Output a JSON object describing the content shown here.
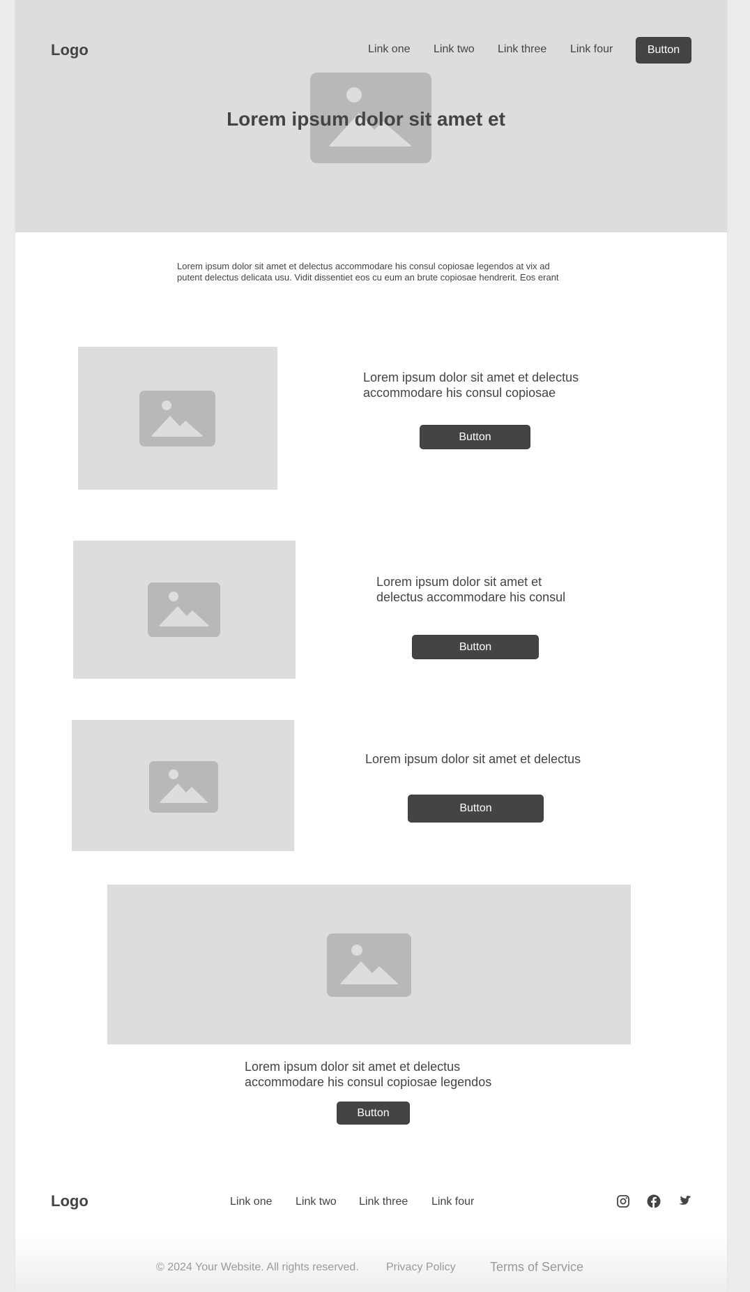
{
  "header": {
    "logo": "Logo",
    "nav": [
      "Link one",
      "Link two",
      "Link three",
      "Link four"
    ],
    "cta_label": "Button"
  },
  "hero": {
    "title": "Lorem ipsum dolor sit amet et",
    "image_icon": "image-placeholder-icon"
  },
  "intro": {
    "text": "Lorem ipsum dolor sit amet et delectus accommodare his consul copiosae legendos at vix ad putent delectus delicata usu. Vidit dissentiet eos cu eum an brute copiosae hendrerit. Eos erant"
  },
  "features": [
    {
      "text": "Lorem ipsum dolor sit amet et delectus accommodare his consul copiosae",
      "button": "Button"
    },
    {
      "text": "Lorem ipsum dolor sit amet et delectus accommodare his consul",
      "button": "Button"
    },
    {
      "text": "Lorem ipsum dolor sit amet et delectus",
      "button": "Button"
    }
  ],
  "banner": {
    "text": "Lorem ipsum dolor sit amet et delectus accommodare his consul copiosae legendos",
    "button": "Button"
  },
  "footer": {
    "logo": "Logo",
    "nav": [
      "Link one",
      "Link two",
      "Link three",
      "Link four"
    ],
    "social": [
      "instagram-icon",
      "facebook-icon",
      "twitter-icon"
    ],
    "copyright": "© 2024 Your Website. All rights reserved.",
    "privacy": "Privacy Policy",
    "terms": "Terms of Service"
  },
  "colors": {
    "placeholder_bg": "#dddddd",
    "placeholder_icon": "#b8b8b8",
    "button_bg": "#444444",
    "text": "#444444"
  }
}
